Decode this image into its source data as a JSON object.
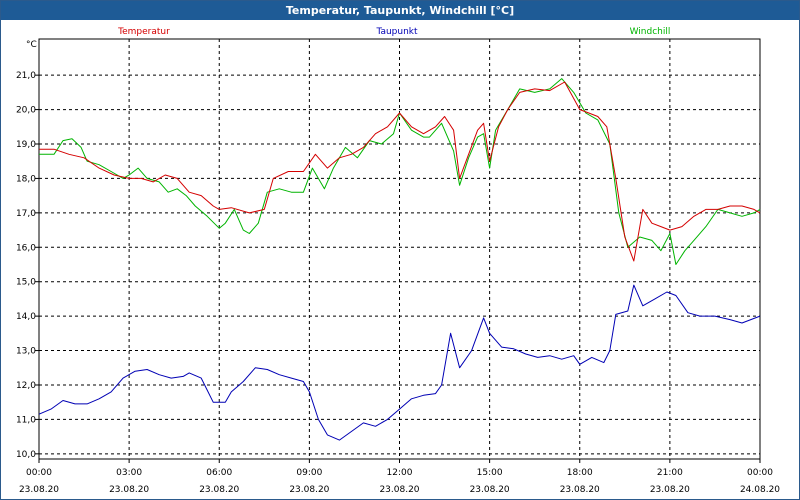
{
  "window": {
    "title": "Temperatur, Taupunkt, Windchill [°C]"
  },
  "chart_data": {
    "type": "line",
    "title": "Temperatur, Taupunkt, Windchill [°C]",
    "ylabel": "°C",
    "ylim": [
      9.85,
      22.05
    ],
    "grid": true,
    "legend_placement": "top",
    "x_tick_labels": [
      {
        "time": "00:00",
        "date": "23.08.20"
      },
      {
        "time": "03:00",
        "date": "23.08.20"
      },
      {
        "time": "06:00",
        "date": "23.08.20"
      },
      {
        "time": "09:00",
        "date": "23.08.20"
      },
      {
        "time": "12:00",
        "date": "23.08.20"
      },
      {
        "time": "15:00",
        "date": "23.08.20"
      },
      {
        "time": "18:00",
        "date": "23.08.20"
      },
      {
        "time": "21:00",
        "date": "23.08.20"
      },
      {
        "time": "00:00",
        "date": "24.08.20"
      }
    ],
    "y_ticks": [
      "10,0",
      "11,0",
      "12,0",
      "13,0",
      "14,0",
      "15,0",
      "16,0",
      "17,0",
      "18,0",
      "19,0",
      "20,0",
      "21,0"
    ],
    "series": [
      {
        "name": "Temperatur",
        "color": "#d40000",
        "points": [
          [
            0.0,
            18.85
          ],
          [
            0.5,
            18.85
          ],
          [
            1.0,
            18.7
          ],
          [
            1.5,
            18.6
          ],
          [
            2.0,
            18.3
          ],
          [
            2.5,
            18.1
          ],
          [
            3.0,
            18.0
          ],
          [
            3.4,
            18.0
          ],
          [
            3.8,
            17.9
          ],
          [
            4.2,
            18.1
          ],
          [
            4.6,
            18.0
          ],
          [
            5.0,
            17.6
          ],
          [
            5.4,
            17.5
          ],
          [
            5.8,
            17.2
          ],
          [
            6.0,
            17.1
          ],
          [
            6.4,
            17.15
          ],
          [
            7.0,
            17.0
          ],
          [
            7.5,
            17.1
          ],
          [
            7.8,
            18.0
          ],
          [
            8.3,
            18.2
          ],
          [
            8.8,
            18.2
          ],
          [
            9.2,
            18.7
          ],
          [
            9.6,
            18.3
          ],
          [
            10.0,
            18.6
          ],
          [
            10.4,
            18.7
          ],
          [
            10.8,
            18.9
          ],
          [
            11.2,
            19.3
          ],
          [
            11.6,
            19.5
          ],
          [
            12.0,
            19.9
          ],
          [
            12.4,
            19.5
          ],
          [
            12.8,
            19.3
          ],
          [
            13.2,
            19.5
          ],
          [
            13.5,
            19.8
          ],
          [
            13.8,
            19.4
          ],
          [
            14.0,
            18.0
          ],
          [
            14.3,
            18.7
          ],
          [
            14.6,
            19.4
          ],
          [
            14.8,
            19.6
          ],
          [
            15.0,
            18.5
          ],
          [
            15.3,
            19.5
          ],
          [
            15.6,
            20.0
          ],
          [
            16.0,
            20.5
          ],
          [
            16.5,
            20.6
          ],
          [
            17.0,
            20.55
          ],
          [
            17.5,
            20.8
          ],
          [
            18.0,
            20.0
          ],
          [
            18.3,
            19.9
          ],
          [
            18.6,
            19.8
          ],
          [
            18.9,
            19.5
          ],
          [
            19.2,
            18.0
          ],
          [
            19.5,
            16.3
          ],
          [
            19.8,
            15.6
          ],
          [
            20.1,
            17.1
          ],
          [
            20.4,
            16.7
          ],
          [
            20.7,
            16.6
          ],
          [
            21.0,
            16.5
          ],
          [
            21.4,
            16.6
          ],
          [
            21.8,
            16.9
          ],
          [
            22.2,
            17.1
          ],
          [
            22.6,
            17.1
          ],
          [
            23.0,
            17.2
          ],
          [
            23.4,
            17.2
          ],
          [
            23.8,
            17.1
          ],
          [
            24.0,
            17.0
          ]
        ]
      },
      {
        "name": "Taupunkt",
        "color": "#0000b4",
        "points": [
          [
            0.0,
            11.15
          ],
          [
            0.4,
            11.3
          ],
          [
            0.8,
            11.55
          ],
          [
            1.2,
            11.45
          ],
          [
            1.6,
            11.45
          ],
          [
            2.0,
            11.6
          ],
          [
            2.4,
            11.8
          ],
          [
            2.8,
            12.2
          ],
          [
            3.2,
            12.4
          ],
          [
            3.6,
            12.45
          ],
          [
            4.0,
            12.3
          ],
          [
            4.4,
            12.2
          ],
          [
            4.8,
            12.25
          ],
          [
            5.0,
            12.35
          ],
          [
            5.4,
            12.2
          ],
          [
            5.6,
            11.85
          ],
          [
            5.8,
            11.5
          ],
          [
            6.2,
            11.5
          ],
          [
            6.4,
            11.8
          ],
          [
            6.8,
            12.1
          ],
          [
            7.2,
            12.5
          ],
          [
            7.6,
            12.45
          ],
          [
            8.0,
            12.3
          ],
          [
            8.4,
            12.2
          ],
          [
            8.8,
            12.1
          ],
          [
            9.0,
            11.8
          ],
          [
            9.3,
            11.0
          ],
          [
            9.6,
            10.55
          ],
          [
            10.0,
            10.4
          ],
          [
            10.4,
            10.65
          ],
          [
            10.8,
            10.9
          ],
          [
            11.2,
            10.8
          ],
          [
            11.6,
            11.0
          ],
          [
            12.0,
            11.3
          ],
          [
            12.4,
            11.6
          ],
          [
            12.8,
            11.7
          ],
          [
            13.2,
            11.75
          ],
          [
            13.4,
            12.0
          ],
          [
            13.7,
            13.5
          ],
          [
            14.0,
            12.5
          ],
          [
            14.4,
            13.0
          ],
          [
            14.8,
            13.95
          ],
          [
            15.0,
            13.5
          ],
          [
            15.4,
            13.1
          ],
          [
            15.8,
            13.05
          ],
          [
            16.2,
            12.9
          ],
          [
            16.6,
            12.8
          ],
          [
            17.0,
            12.85
          ],
          [
            17.4,
            12.75
          ],
          [
            17.8,
            12.85
          ],
          [
            18.0,
            12.6
          ],
          [
            18.4,
            12.8
          ],
          [
            18.8,
            12.65
          ],
          [
            19.0,
            13.0
          ],
          [
            19.2,
            14.05
          ],
          [
            19.6,
            14.15
          ],
          [
            19.8,
            14.9
          ],
          [
            20.1,
            14.3
          ],
          [
            20.5,
            14.5
          ],
          [
            20.9,
            14.7
          ],
          [
            21.2,
            14.6
          ],
          [
            21.6,
            14.1
          ],
          [
            22.0,
            14.0
          ],
          [
            22.5,
            14.0
          ],
          [
            23.0,
            13.9
          ],
          [
            23.4,
            13.8
          ],
          [
            24.0,
            14.0
          ]
        ]
      },
      {
        "name": "Windchill",
        "color": "#00b400",
        "points": [
          [
            0.0,
            18.7
          ],
          [
            0.5,
            18.7
          ],
          [
            0.8,
            19.1
          ],
          [
            1.1,
            19.15
          ],
          [
            1.4,
            18.9
          ],
          [
            1.6,
            18.5
          ],
          [
            2.0,
            18.4
          ],
          [
            2.4,
            18.2
          ],
          [
            2.8,
            18.0
          ],
          [
            3.0,
            18.1
          ],
          [
            3.3,
            18.3
          ],
          [
            3.6,
            18.0
          ],
          [
            4.0,
            17.9
          ],
          [
            4.3,
            17.6
          ],
          [
            4.6,
            17.7
          ],
          [
            4.9,
            17.5
          ],
          [
            5.2,
            17.2
          ],
          [
            5.6,
            16.9
          ],
          [
            6.0,
            16.55
          ],
          [
            6.2,
            16.7
          ],
          [
            6.5,
            17.1
          ],
          [
            6.8,
            16.5
          ],
          [
            7.0,
            16.4
          ],
          [
            7.3,
            16.7
          ],
          [
            7.6,
            17.6
          ],
          [
            8.0,
            17.7
          ],
          [
            8.4,
            17.6
          ],
          [
            8.8,
            17.6
          ],
          [
            9.1,
            18.3
          ],
          [
            9.5,
            17.7
          ],
          [
            9.8,
            18.3
          ],
          [
            10.2,
            18.9
          ],
          [
            10.6,
            18.6
          ],
          [
            11.0,
            19.1
          ],
          [
            11.4,
            19.0
          ],
          [
            11.8,
            19.3
          ],
          [
            12.0,
            19.9
          ],
          [
            12.4,
            19.4
          ],
          [
            12.8,
            19.2
          ],
          [
            13.0,
            19.2
          ],
          [
            13.4,
            19.6
          ],
          [
            13.8,
            18.8
          ],
          [
            14.0,
            17.8
          ],
          [
            14.3,
            18.6
          ],
          [
            14.6,
            19.2
          ],
          [
            14.8,
            19.3
          ],
          [
            15.0,
            18.3
          ],
          [
            15.2,
            19.4
          ],
          [
            15.6,
            20.0
          ],
          [
            16.0,
            20.6
          ],
          [
            16.5,
            20.5
          ],
          [
            17.0,
            20.6
          ],
          [
            17.4,
            20.9
          ],
          [
            17.8,
            20.5
          ],
          [
            18.2,
            19.9
          ],
          [
            18.6,
            19.7
          ],
          [
            19.0,
            19.0
          ],
          [
            19.3,
            17.0
          ],
          [
            19.6,
            16.0
          ],
          [
            20.0,
            16.3
          ],
          [
            20.4,
            16.2
          ],
          [
            20.7,
            15.9
          ],
          [
            21.0,
            16.4
          ],
          [
            21.2,
            15.5
          ],
          [
            21.5,
            15.9
          ],
          [
            21.8,
            16.2
          ],
          [
            22.2,
            16.6
          ],
          [
            22.6,
            17.1
          ],
          [
            23.0,
            17.0
          ],
          [
            23.4,
            16.9
          ],
          [
            23.8,
            17.0
          ],
          [
            24.0,
            17.1
          ]
        ]
      }
    ]
  }
}
